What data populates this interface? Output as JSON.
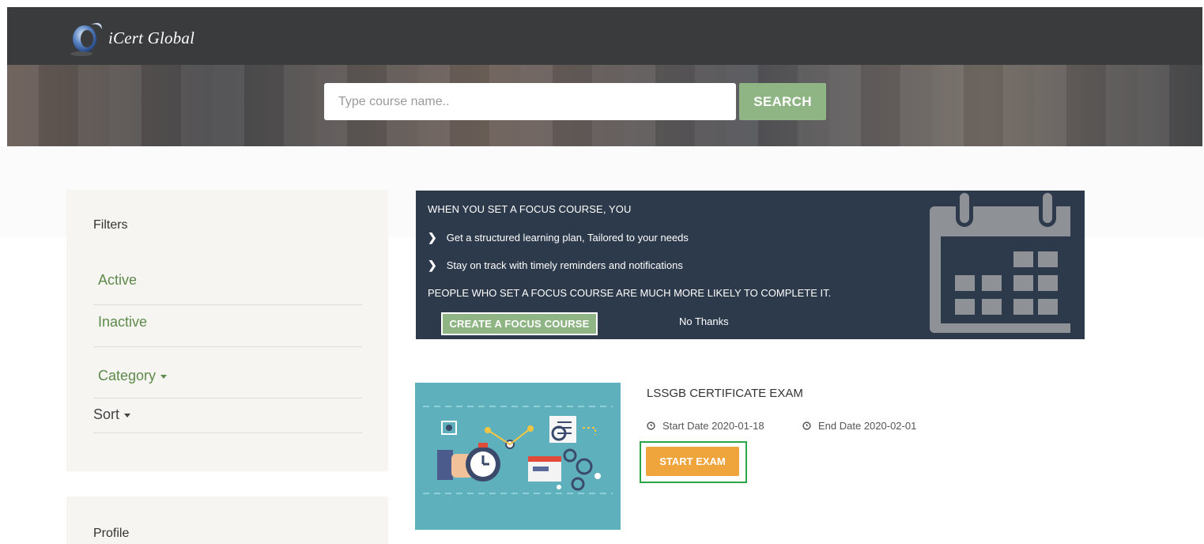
{
  "brand": {
    "logo_text": "iCert Global",
    "primary_color": "#3a3b3d",
    "accent_green": "#8fb584",
    "accent_orange": "#f0a43c"
  },
  "search": {
    "placeholder": "Type course name..",
    "button_label": "SEARCH"
  },
  "sidebar": {
    "filters_title": "Filters",
    "items": [
      {
        "label": "Active"
      },
      {
        "label": "Inactive"
      },
      {
        "label": "Category"
      },
      {
        "label": "Sort"
      }
    ],
    "profile_title": "Profile"
  },
  "focus_banner": {
    "heading": "WHEN YOU SET A FOCUS COURSE, YOU",
    "bullets": [
      "Get a structured learning plan, Tailored to your needs",
      "Stay on track with timely reminders and notifications"
    ],
    "people_text": "PEOPLE WHO SET A FOCUS COURSE ARE MUCH MORE LIKELY TO COMPLETE IT.",
    "create_button": "CREATE A FOCUS COURSE",
    "no_thanks": "No Thanks",
    "icon": "calendar-icon"
  },
  "course": {
    "title": "LSSGB CERTIFICATE EXAM",
    "start_date": "Start Date 2020-01-18",
    "end_date": "End Date 2020-02-01",
    "button_label": "START EXAM"
  }
}
